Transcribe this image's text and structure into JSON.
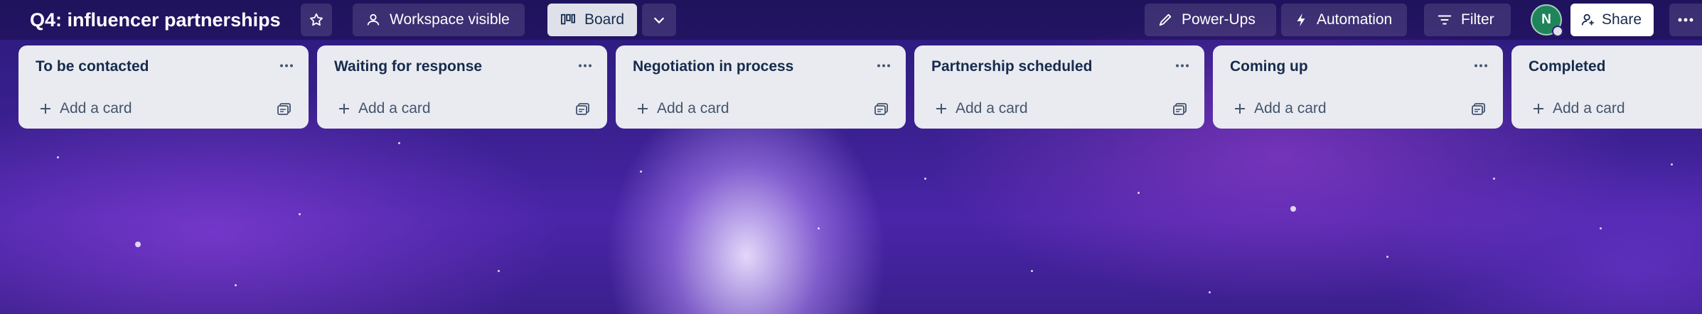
{
  "header": {
    "board_title": "Q4: influencer partnerships",
    "visibility_label": "Workspace visible",
    "view_label": "Board",
    "powerups_label": "Power-Ups",
    "automation_label": "Automation",
    "filter_label": "Filter",
    "avatar_initial": "N",
    "share_label": "Share"
  },
  "lists": [
    {
      "title": "To be contacted",
      "add_label": "Add a card"
    },
    {
      "title": "Waiting for response",
      "add_label": "Add a card"
    },
    {
      "title": "Negotiation in process",
      "add_label": "Add a card"
    },
    {
      "title": "Partnership scheduled",
      "add_label": "Add a card"
    },
    {
      "title": "Coming up",
      "add_label": "Add a card"
    },
    {
      "title": "Completed",
      "add_label": "Add a card"
    }
  ],
  "icons": {
    "star": "star-icon",
    "visibility": "people-icon",
    "board": "board-icon",
    "dropdown": "chevron-down-icon",
    "powerups": "rocket-icon",
    "automation": "lightning-icon",
    "filter": "filter-icon",
    "share": "add-person-icon",
    "more": "more-icon",
    "list_menu": "ellipsis-icon",
    "add": "plus-icon",
    "template": "card-template-icon"
  },
  "colors": {
    "avatar": "#1f845a",
    "list_bg": "#e9ebf0",
    "title_text": "#172b4d"
  }
}
